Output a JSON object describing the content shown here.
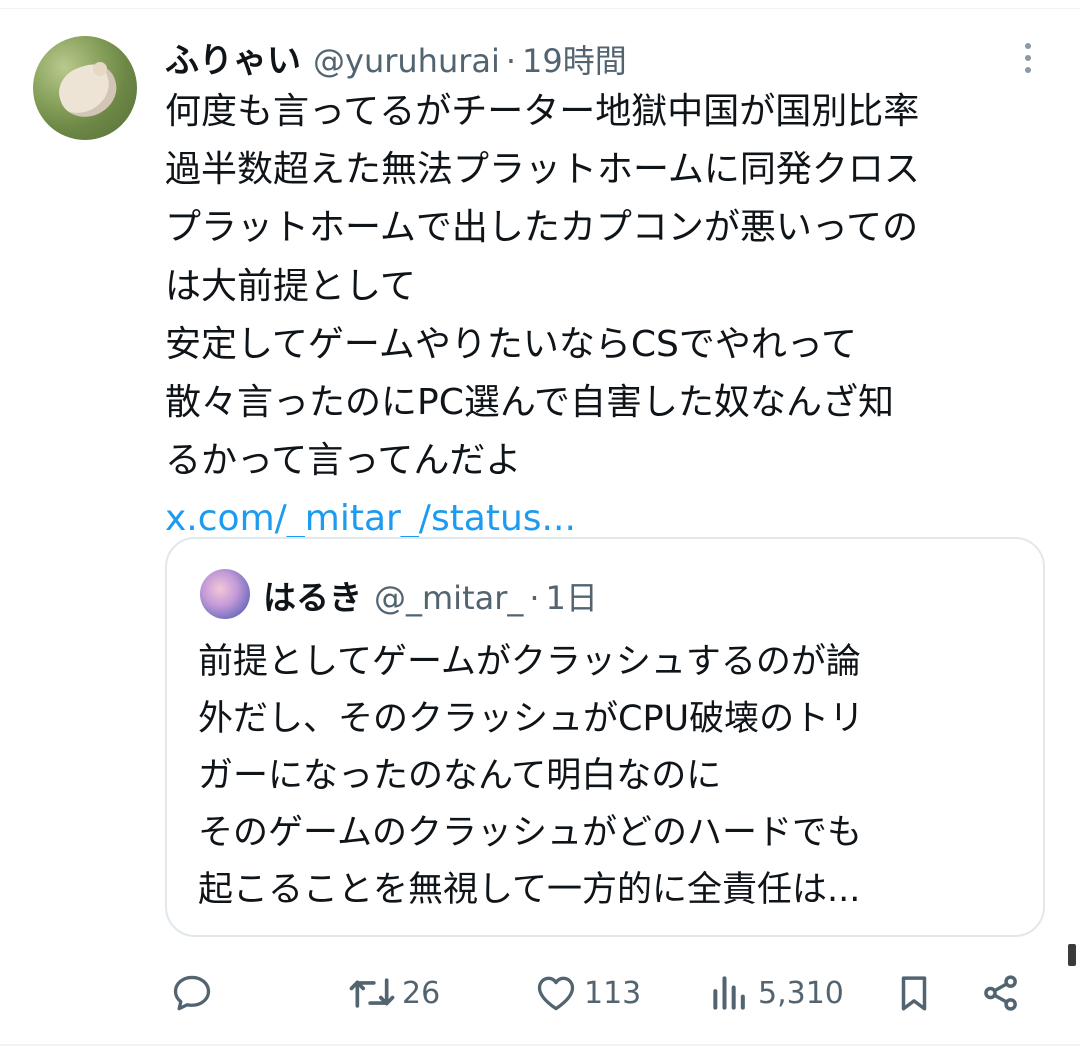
{
  "tweet": {
    "author_name": "ふりゃい",
    "handle": "@yuruhurai",
    "separator": "·",
    "time": "19時間",
    "text_lines": [
      "何度も言ってるがチーター地獄中国が国別比率",
      "過半数超えた無法プラットホームに同発クロス",
      "プラットホームで出したカプコンが悪いっての",
      "は大前提として",
      "安定してゲームやりたいならCSでやれって",
      "散々言ったのにPC選んで自害した奴なんざ知",
      "るかって言ってんだよ"
    ],
    "link": "x.com/_mitar_/status..."
  },
  "quote": {
    "author_name": "はるき",
    "handle": "@_mitar_",
    "separator": "·",
    "time": "1日",
    "text_lines": [
      "前提としてゲームがクラッシュするのが論",
      "外だし、そのクラッシュがCPU破壊のトリ",
      "ガーになったのなんて明白なのに",
      "そのゲームのクラッシュがどのハードでも",
      "起こることを無視して一方的に全責任は..."
    ]
  },
  "actions": {
    "reply": {
      "icon": "reply-icon",
      "count": ""
    },
    "retweet": {
      "icon": "retweet-icon",
      "count": "26"
    },
    "like": {
      "icon": "heart-icon",
      "count": "113"
    },
    "views": {
      "icon": "views-icon",
      "count": "5,310"
    },
    "bookmark": {
      "icon": "bookmark-icon"
    },
    "share": {
      "icon": "share-icon"
    }
  },
  "colors": {
    "text": "#0f1419",
    "secondary": "#536471",
    "link": "#1d9bf0",
    "border": "#e1e8ed"
  }
}
